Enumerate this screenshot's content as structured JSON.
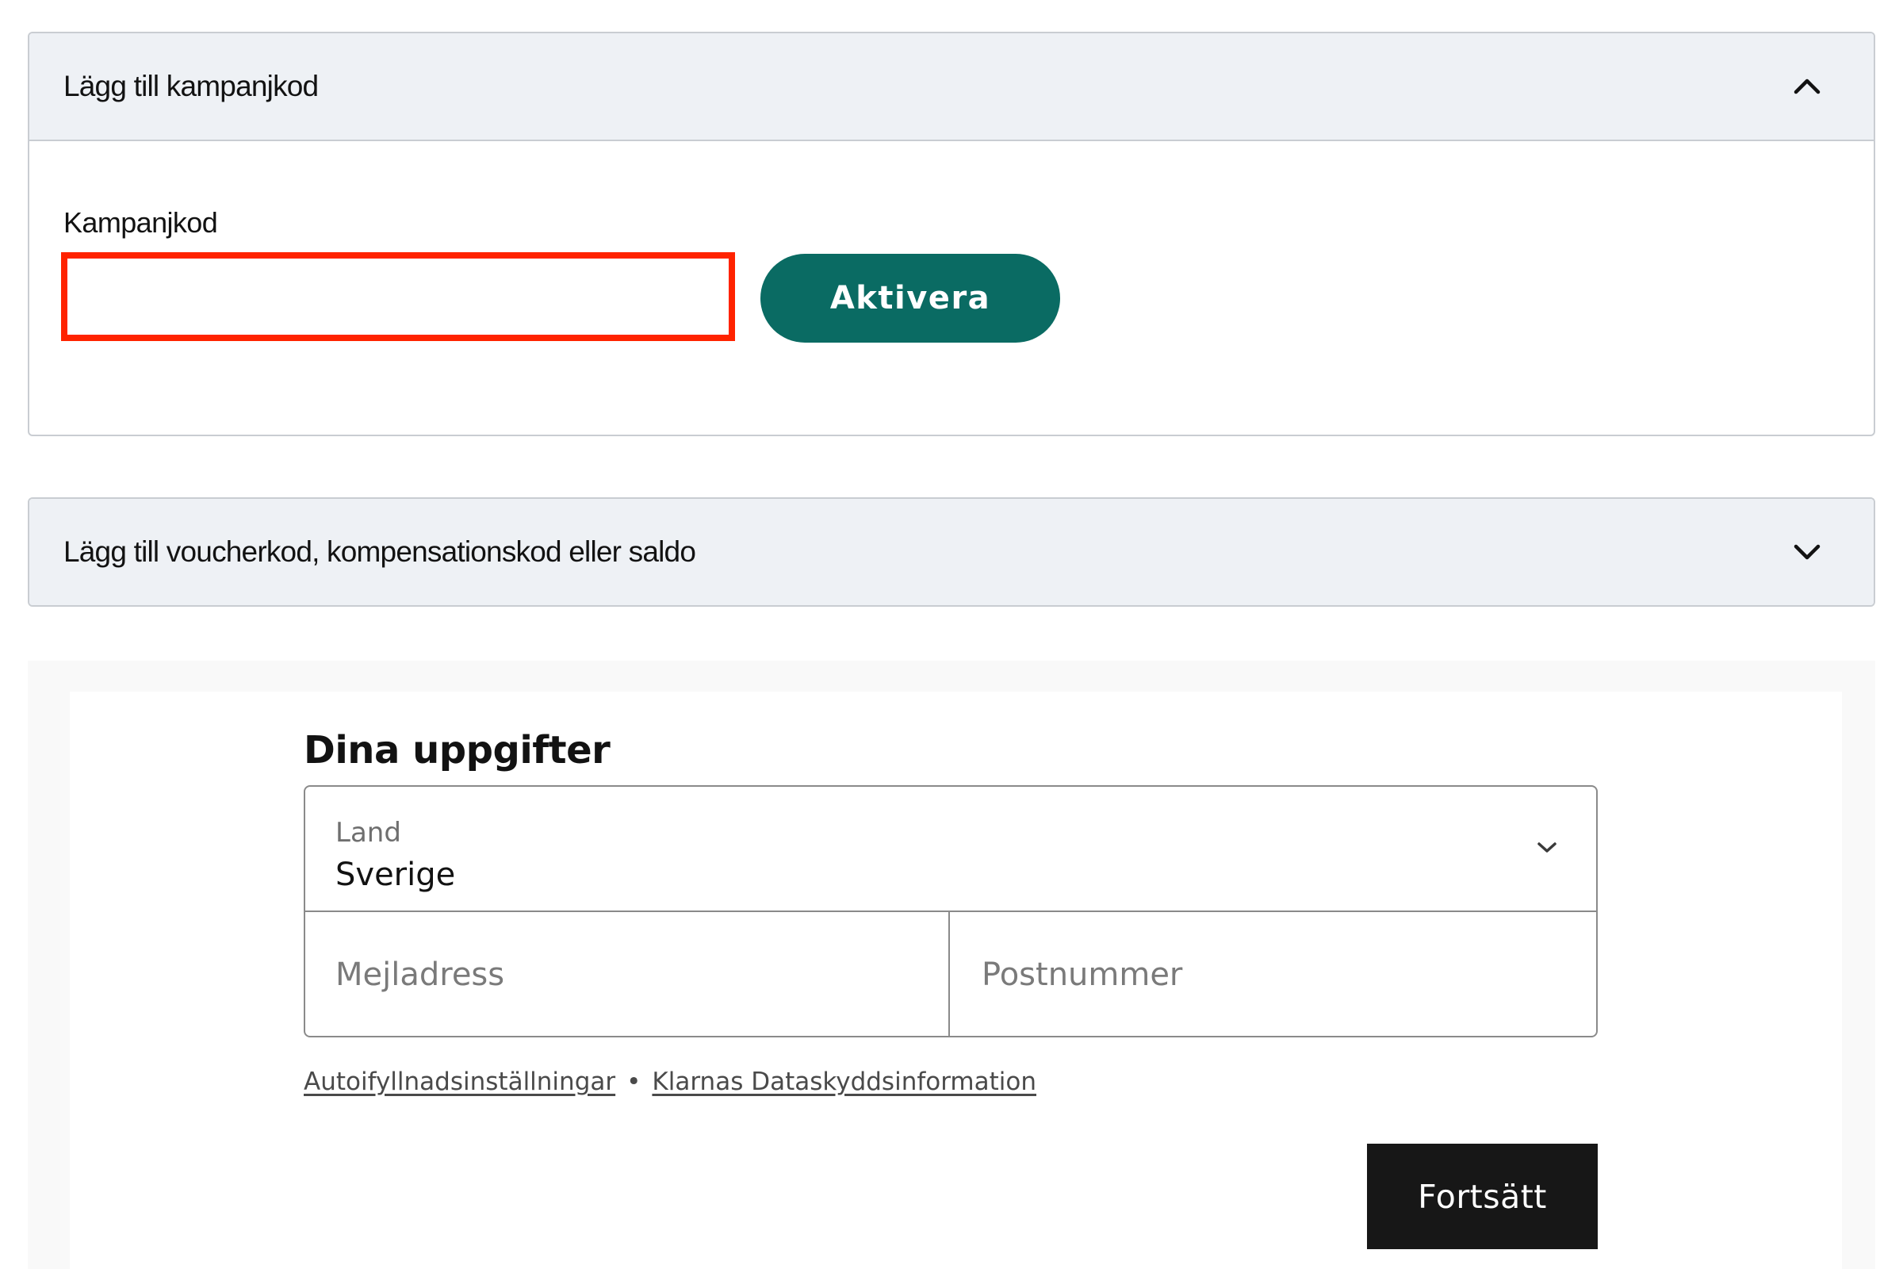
{
  "promo_accordion": {
    "title": "Lägg till kampanjkod",
    "state": "expanded",
    "chevron_icon": "chevron-up-icon",
    "field_label": "Kampanjkod",
    "input_value": "",
    "activate_label": "Aktivera",
    "activate_color": "#0a6b63",
    "highlight_color": "#ff2300"
  },
  "voucher_accordion": {
    "title": "Lägg till voucherkod, kompensationskod eller saldo",
    "state": "collapsed",
    "chevron_icon": "chevron-down-icon"
  },
  "details": {
    "title": "Dina uppgifter",
    "country": {
      "label": "Land",
      "value": "Sverige",
      "chevron_icon": "chevron-down-icon"
    },
    "email_placeholder": "Mejladress",
    "postal_placeholder": "Postnummer",
    "links": {
      "autofill": "Autoifyllnadsinställningar",
      "separator": "•",
      "privacy": "Klarnas Dataskyddsinformation"
    },
    "continue_label": "Fortsätt"
  }
}
